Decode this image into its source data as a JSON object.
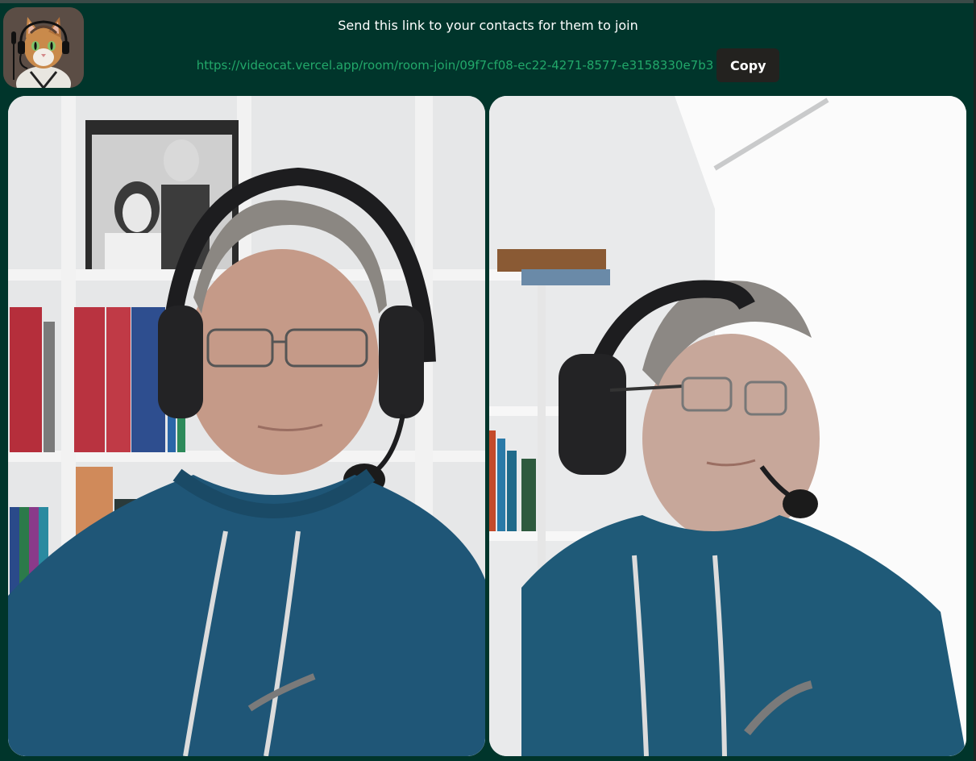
{
  "app": {
    "logo_icon": "cat-with-headset-logo-icon"
  },
  "header": {
    "invite_text": "Send this link to your contacts for them to join",
    "room_link": "https://videocat.vercel.app/room/room-join/09f7cf08-ec22-4271-8577-e3158330e7b3",
    "copy_label": "Copy"
  },
  "videos": [
    {
      "id": "local-video",
      "description_icon": "video-feed-icon"
    },
    {
      "id": "remote-video",
      "description_icon": "video-feed-icon"
    }
  ],
  "colors": {
    "background": "#00352b",
    "link": "#22a86a",
    "button_bg": "#23221f",
    "hoodie": "#1f5677"
  }
}
